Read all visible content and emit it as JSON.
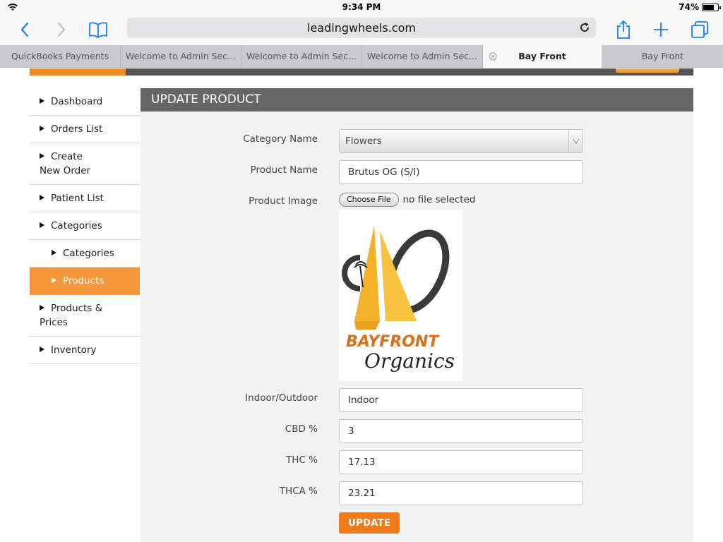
{
  "status_bar": {
    "time": "9:34 PM",
    "battery": "74%",
    "battery_level": 0.74
  },
  "toolbar": {
    "url": "leadingwheels.com",
    "icons": [
      "back-icon",
      "forward-icon",
      "bookmarks-icon",
      "reload-icon",
      "share-icon",
      "new-tab-icon",
      "tabs-icon"
    ]
  },
  "tabs": [
    {
      "label": "QuickBooks Payments",
      "active": false
    },
    {
      "label": "Welcome to Admin Sec...",
      "active": false
    },
    {
      "label": "Welcome to Admin Sec...",
      "active": false
    },
    {
      "label": "Welcome to Admin Sec...",
      "active": false
    },
    {
      "label": "Bay Front",
      "active": true
    },
    {
      "label": "Bay Front",
      "active": false
    }
  ],
  "sidebar": {
    "items": [
      {
        "label": "Dashboard"
      },
      {
        "label": "Orders List"
      },
      {
        "label": "Create New Order"
      },
      {
        "label": "Patient List"
      },
      {
        "label": "Categories"
      },
      {
        "label": "Categories"
      },
      {
        "label": "Products"
      },
      {
        "label": "Products & Prices"
      },
      {
        "label": "Inventory"
      }
    ]
  },
  "form": {
    "title": "UPDATE PRODUCT",
    "category_label": "Category Name",
    "category_value": "Flowers",
    "product_name_label": "Product Name",
    "product_name_value": "Brutus OG (S/I)",
    "image_label": "Product Image",
    "choose_file": "Choose File",
    "no_file": "no file selected",
    "logo_text_1": "BAYFRONT",
    "logo_text_2": "Organics",
    "indoor_label": "Indoor/Outdoor",
    "indoor_value": "Indoor",
    "cbd_label": "CBD %",
    "cbd_value": "3",
    "thc_label": "THC %",
    "thc_value": "17.13",
    "thca_label": "THCA %",
    "thca_value": "23.21",
    "update_label": "UPDATE"
  },
  "colors": {
    "accent": "#f07b1a",
    "sidebar_active": "#f7963a",
    "panel_header": "#666666",
    "ios_blue": "#1a7cf5"
  }
}
